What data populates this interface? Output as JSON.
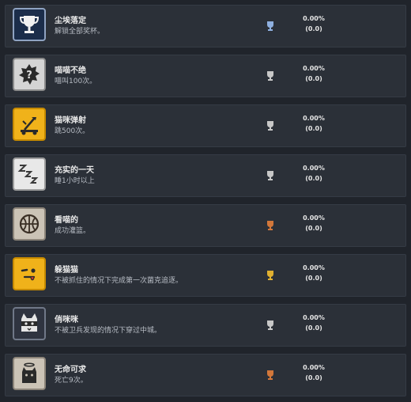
{
  "trophies": [
    {
      "title": "尘埃落定",
      "desc": "解锁全部奖杯。",
      "percent": "0.00%",
      "count": "(0.0)",
      "icon": "platinum-trophy-icon",
      "grade": "platinum",
      "grade_color": "#8fb0e0"
    },
    {
      "title": "喵喵不绝",
      "desc": "喵叫100次。",
      "percent": "0.00%",
      "count": "(0.0)",
      "icon": "question-splat-icon",
      "grade": "silver",
      "grade_color": "#c8c8c8"
    },
    {
      "title": "猫咪弹射",
      "desc": "跳500次。",
      "percent": "0.00%",
      "count": "(0.0)",
      "icon": "catapult-icon",
      "grade": "silver",
      "grade_color": "#c8c8c8"
    },
    {
      "title": "充实的一天",
      "desc": "睡1小时以上",
      "percent": "0.00%",
      "count": "(0.0)",
      "icon": "sleep-zzz-icon",
      "grade": "silver",
      "grade_color": "#c8c8c8"
    },
    {
      "title": "看喵的",
      "desc": "成功灌篮。",
      "percent": "0.00%",
      "count": "(0.0)",
      "icon": "basketball-icon",
      "grade": "bronze",
      "grade_color": "#d2773a"
    },
    {
      "title": "躲猫猫",
      "desc": "不被抓住的情况下完成第一次菌克追逐。",
      "percent": "0.00%",
      "count": "(0.0)",
      "icon": "wink-face-icon",
      "grade": "gold",
      "grade_color": "#e0b030"
    },
    {
      "title": "俏咪咪",
      "desc": "不被卫兵发现的情况下穿过中城。",
      "percent": "0.00%",
      "count": "(0.0)",
      "icon": "bandit-cat-icon",
      "grade": "silver",
      "grade_color": "#c8c8c8"
    },
    {
      "title": "无命可求",
      "desc": "死亡9次。",
      "percent": "0.00%",
      "count": "(0.0)",
      "icon": "ghost-cat-icon",
      "grade": "bronze",
      "grade_color": "#d2773a"
    }
  ]
}
